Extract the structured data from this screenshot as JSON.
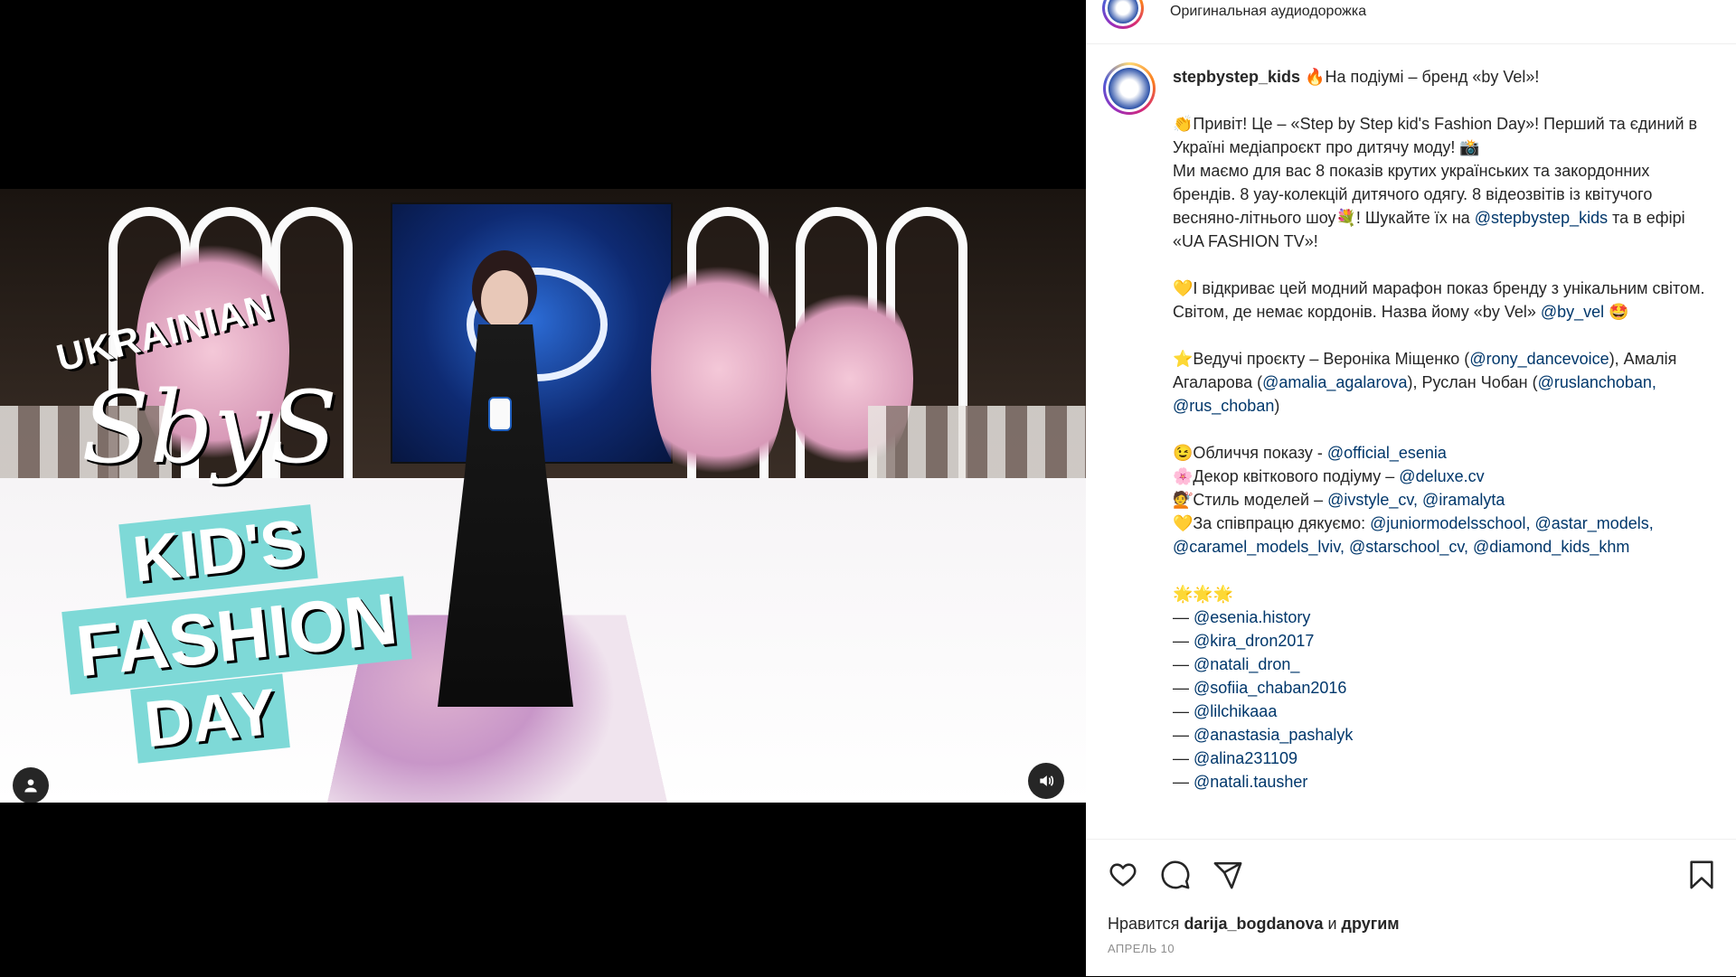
{
  "video": {
    "overlay_ukrainian": "UKRAINIAN",
    "overlay_sbs": "SbyS",
    "overlay_kids": "KID'S",
    "overlay_fashion": "FASHION",
    "overlay_day": "DAY",
    "screen_text": "KIDS FASHION DAY"
  },
  "panel": {
    "audio_label": "Оригинальная аудиодорожка"
  },
  "caption": {
    "username": "stepbystep_kids",
    "lines": [
      {
        "t": "🔥На подіумі – бренд «by Vel»!"
      },
      {
        "gap": true
      },
      {
        "t": "👏Привіт! Це – «Step by Step kid's Fashion Day»! Перший та єдиний в Україні медіапроєкт про дитячу моду! 📸"
      },
      {
        "t": "Ми маємо для вас 8 показів крутих українських та закордонних брендів. 8 уау-колекцій дитячого одягу. 8 відеозвітів із квітучого весняно-літнього шоу💐! Шукайте їх на ",
        "m": "@stepbystep_kids",
        "t2": " та в ефірі «UA FASHION TV»!"
      },
      {
        "gap": true
      },
      {
        "t": "💛І відкриває цей модний марафон показ бренду з унікальним світом. Світом, де немає кордонів. Назва йому «by Vel» ",
        "m": "@by_vel",
        "t2": " 🤩"
      },
      {
        "gap": true
      },
      {
        "t": "⭐Ведучі проєкту – Вероніка Міщенко (",
        "m": "@rony_dancevoice",
        "t2": "), Амалія Агаларова (",
        "m2": "@amalia_agalarova",
        "t3": "), Руслан Чобан (",
        "m3": "@ruslanchoban, @rus_choban",
        "t4": ")"
      },
      {
        "gap": true
      },
      {
        "t": "😉Обличчя показу - ",
        "m": "@official_esenia"
      },
      {
        "t": "🌸Декор квіткового подіуму – ",
        "m": "@deluxe.cv"
      },
      {
        "t": "💇Стиль моделей – ",
        "m": "@ivstyle_cv, @iramalyta"
      },
      {
        "t": "💛За співпрацю дякуємо: ",
        "m": "@juniormodelsschool, @astar_models, @caramel_models_lviv, @starschool_cv, @diamond_kids_khm"
      },
      {
        "gap": true
      },
      {
        "t": "🌟🌟🌟"
      },
      {
        "t": "— ",
        "m": "@esenia.history"
      },
      {
        "t": "— ",
        "m": "@kira_dron2017"
      },
      {
        "t": "— ",
        "m": "@natali_dron_"
      },
      {
        "t": "— ",
        "m": "@sofiia_chaban2016"
      },
      {
        "t": "— ",
        "m": "@lilchikaaa"
      },
      {
        "t": "— ",
        "m": "@anastasia_pashalyk"
      },
      {
        "t": "— ",
        "m": "@alina231109"
      },
      {
        "t": "— ",
        "m": "@natali.tausher"
      }
    ]
  },
  "likes": {
    "prefix": "Нравится ",
    "user": "darija_bogdanova",
    "middle": " и ",
    "others": "другим"
  },
  "date": "АПРЕЛЬ 10",
  "icons": {
    "like": "heart-icon",
    "comment": "comment-icon",
    "share": "share-icon",
    "save": "bookmark-icon",
    "user": "user-icon",
    "mute": "speaker-icon"
  }
}
